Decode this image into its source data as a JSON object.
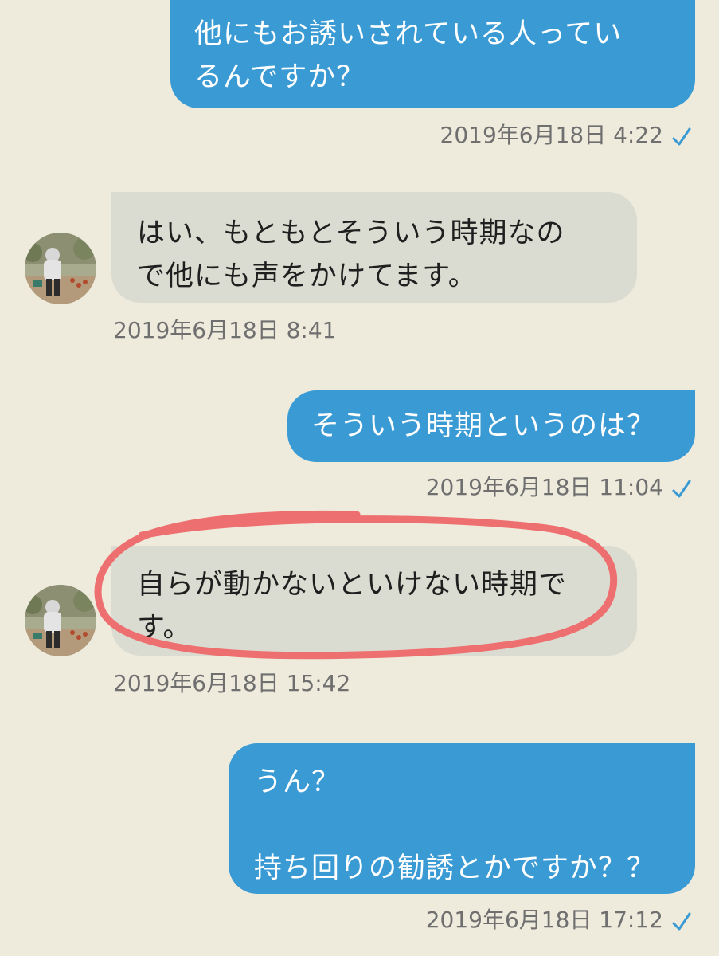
{
  "messages": [
    {
      "direction": "out",
      "text": "他にもお誘いされている人ってい\nるんですか？",
      "time": "2019年6月18日 4:22",
      "status_icon": "read-check-icon"
    },
    {
      "direction": "in",
      "text": "はい、もともとそういう時期なの\nで他にも声をかけてます。",
      "time": "2019年6月18日 8:41",
      "avatar_icon": "contact-avatar"
    },
    {
      "direction": "out",
      "text": "そういう時期というのは？",
      "time": "2019年6月18日 11:04",
      "status_icon": "read-check-icon"
    },
    {
      "direction": "in",
      "text": "自らが動かないといけない時期で\nす。",
      "time": "2019年6月18日 15:42",
      "avatar_icon": "contact-avatar",
      "highlighted": true
    },
    {
      "direction": "out",
      "text": "うん？\n\n持ち回りの勧誘とかですか？？",
      "time": "2019年6月18日 17:12",
      "status_icon": "read-check-icon"
    }
  ],
  "colors": {
    "background": "#eeeadc",
    "outgoing_bubble": "#3a9ad3",
    "incoming_bubble": "#dbdcd1",
    "timestamp_text": "#6f6f6f",
    "read_check": "#3a9ad3",
    "annotation_marker": "#ee6f6f"
  }
}
